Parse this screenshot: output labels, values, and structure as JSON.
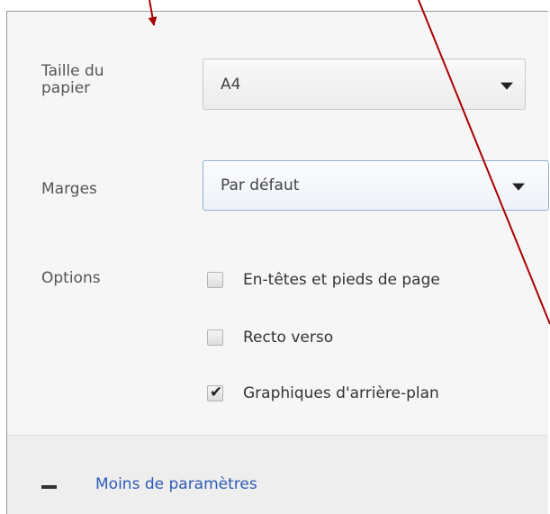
{
  "paper_size": {
    "label": "Taille du\npapier",
    "value": "A4"
  },
  "margins": {
    "label": "Marges",
    "value": "Par défaut"
  },
  "options": {
    "label": "Options",
    "items": [
      {
        "label": "En-têtes et pieds de page",
        "checked": false
      },
      {
        "label": "Recto verso",
        "checked": false
      },
      {
        "label": "Graphiques d'arrière-plan",
        "checked": true
      }
    ]
  },
  "footer": {
    "link_label": "Moins de paramètres"
  },
  "colors": {
    "annotation_arrow": "#aa0000",
    "link": "#2f5ab6",
    "focus_border": "#94b1d8"
  },
  "icons": {
    "dropdown": "caret-down-icon",
    "check": "check-icon",
    "collapse": "minus-icon"
  }
}
